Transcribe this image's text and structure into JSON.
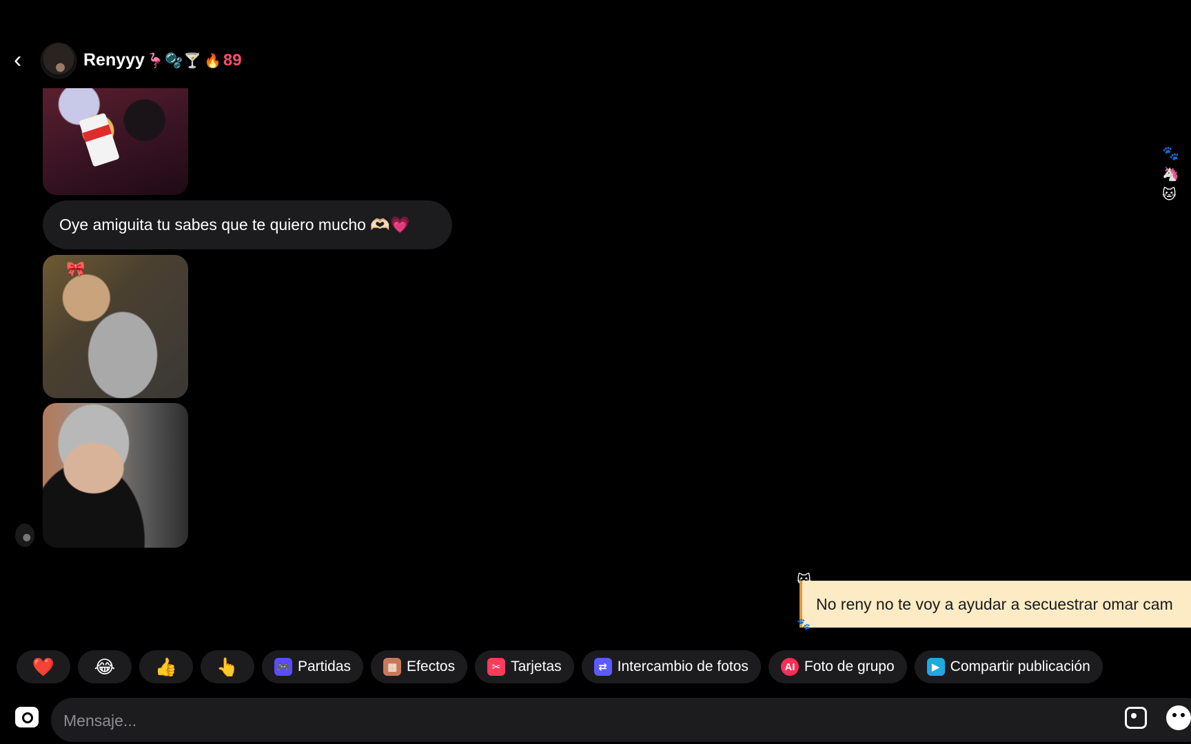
{
  "header": {
    "username": "Renyyy",
    "username_emojis": "🦩🫧🍸",
    "streak_icon": "🔥",
    "streak_count": "89"
  },
  "messages": {
    "text_bubble": "Oye amiguita  tu sabes que te quiero mucho 🫶🏻💗",
    "note_text": "No reny no te voy a ayudar a secuestrar omar cam"
  },
  "quick_actions": [
    {
      "label": "❤️",
      "icon": "heart-emoji"
    },
    {
      "label": "😂",
      "icon": "laughing-emoji"
    },
    {
      "label": "👍",
      "icon": "thumbs-up-emoji"
    },
    {
      "label": "👆",
      "icon": "pointing-emoji"
    },
    {
      "label": "Partidas",
      "icon": "gamepad-icon",
      "color": "#5a4cff"
    },
    {
      "label": "Efectos",
      "icon": "effects-icon",
      "color": "#c77a5a"
    },
    {
      "label": "Tarjetas",
      "icon": "cards-icon",
      "color": "#ff3b5c"
    },
    {
      "label": "Intercambio de fotos",
      "icon": "photo-swap-icon",
      "color": "#5b5bff"
    },
    {
      "label": "Foto de grupo",
      "icon": "ai-icon",
      "color": "#ff2d55"
    },
    {
      "label": "Compartir publicación",
      "icon": "share-post-icon",
      "color": "#20a8e0"
    }
  ],
  "composer": {
    "placeholder": "Mensaje..."
  },
  "colors": {
    "background": "#000000",
    "bubble": "#1c1c1e",
    "streak": "#ff4d6d",
    "note": "#fcebc4"
  }
}
